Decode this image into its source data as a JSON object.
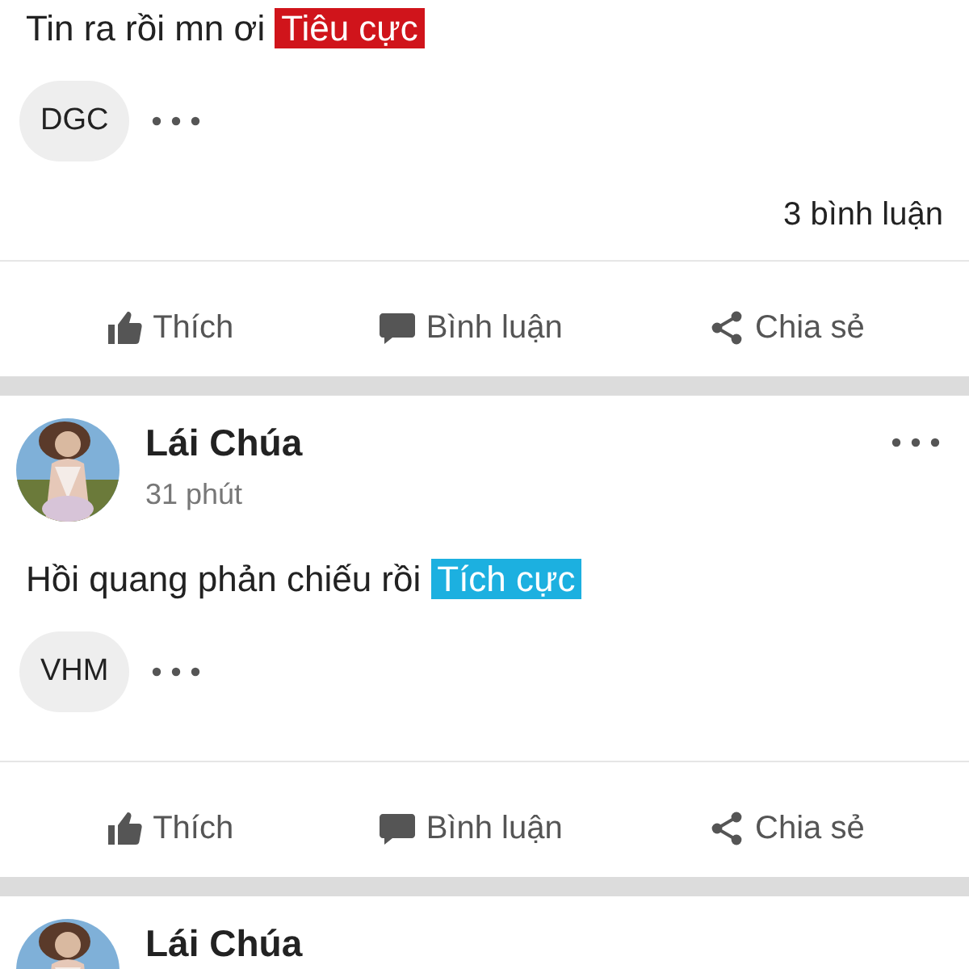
{
  "posts": [
    {
      "text": "Tin ra rồi mn ơi",
      "tag": {
        "label": "Tiêu cực",
        "kind": "negative"
      },
      "stock": "DGC",
      "comments": "3 bình luận",
      "actions": [
        "Thích",
        "Bình luận",
        "Chia sẻ"
      ]
    },
    {
      "author": "Lái Chúa",
      "time": "31 phút",
      "text": "Hồi quang phản chiếu rồi",
      "tag": {
        "label": "Tích cực",
        "kind": "positive"
      },
      "stock": "VHM",
      "actions": [
        "Thích",
        "Bình luận",
        "Chia sẻ"
      ]
    },
    {
      "author": "Lái Chúa"
    }
  ]
}
